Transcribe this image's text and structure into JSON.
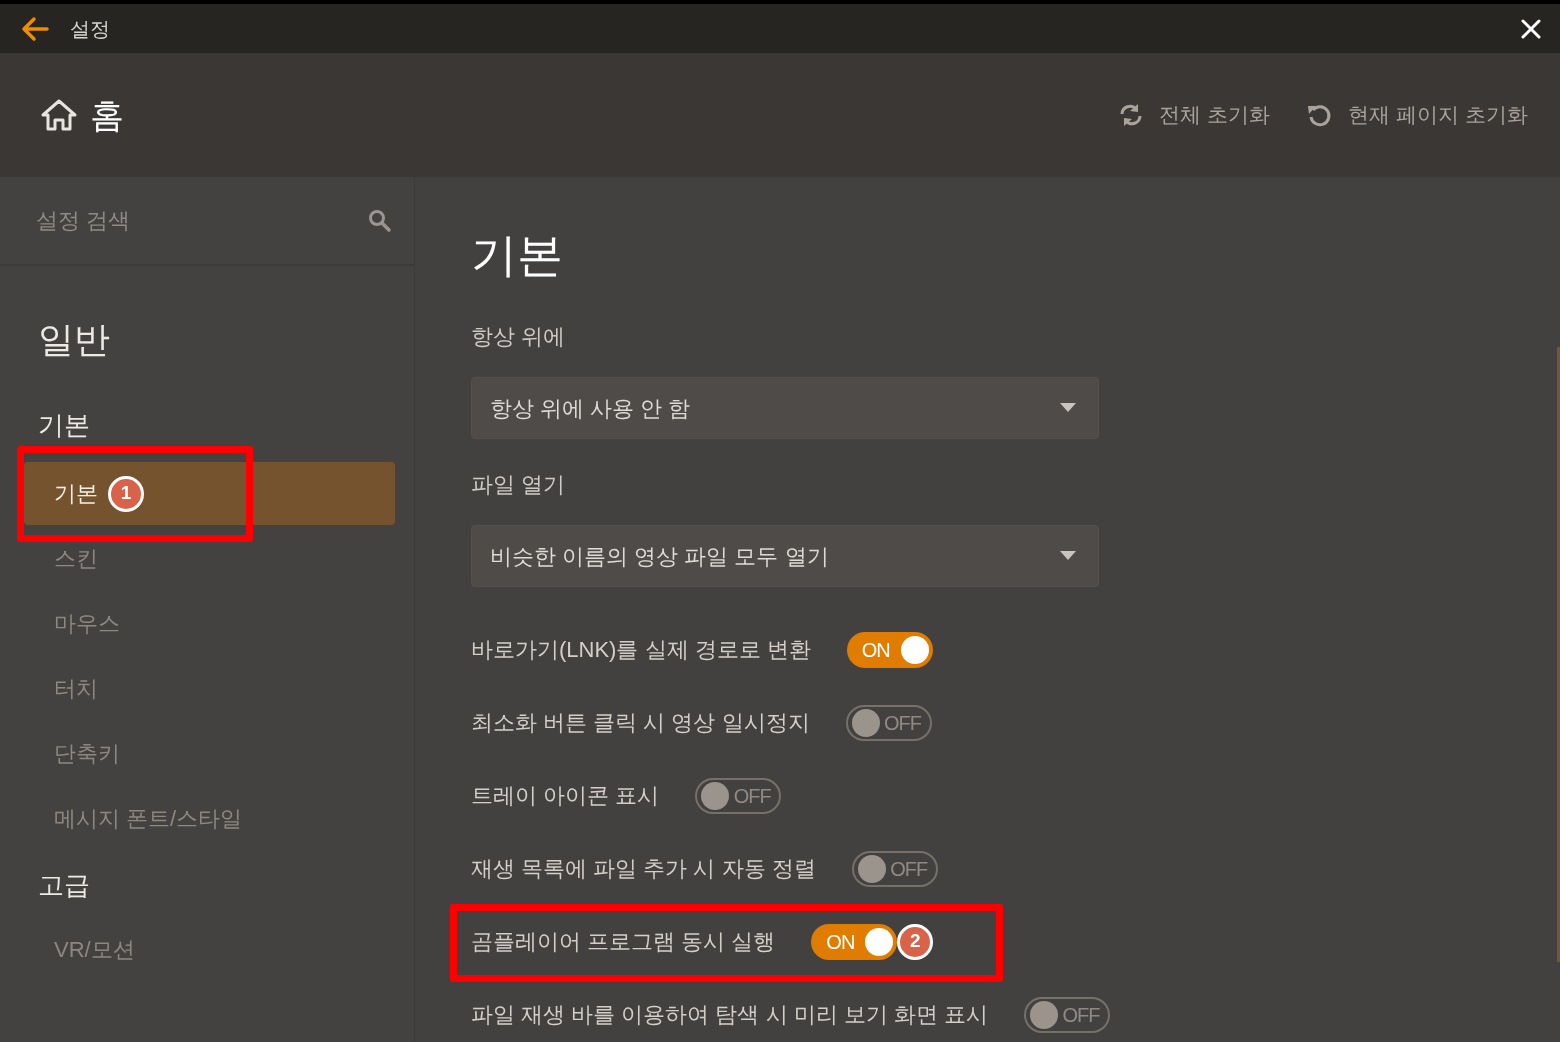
{
  "window": {
    "title": "설정"
  },
  "header": {
    "title": "홈",
    "actions": [
      {
        "label": "전체 초기화",
        "kind": "reset-all"
      },
      {
        "label": "현재 페이지 초기화",
        "kind": "reset-page"
      }
    ]
  },
  "sidebar": {
    "search": {
      "placeholder": "설정 검색"
    },
    "sections": [
      {
        "title": "일반",
        "groups": [
          {
            "title": "기본",
            "items": [
              {
                "label": "기본",
                "selected": true,
                "callout": "1"
              },
              {
                "label": "스킨",
                "selected": false
              },
              {
                "label": "마우스",
                "selected": false
              },
              {
                "label": "터치",
                "selected": false
              },
              {
                "label": "단축키",
                "selected": false
              },
              {
                "label": "메시지 폰트/스타일",
                "selected": false
              }
            ]
          },
          {
            "title": "고급",
            "items": [
              {
                "label": "VR/모션",
                "selected": false
              }
            ]
          }
        ]
      }
    ]
  },
  "content": {
    "title": "기본",
    "settings": [
      {
        "kind": "dropdown",
        "label": "항상 위에",
        "value": "항상 위에 사용 안 함"
      },
      {
        "kind": "dropdown",
        "label": "파일 열기",
        "value": "비슷한 이름의 영상 파일 모두 열기"
      },
      {
        "kind": "toggle",
        "label": "바로가기(LNK)를 실제 경로로 변환",
        "on": true,
        "state_text": "ON"
      },
      {
        "kind": "toggle",
        "label": "최소화 버튼 클릭 시 영상 일시정지",
        "on": false,
        "state_text": "OFF"
      },
      {
        "kind": "toggle",
        "label": "트레이 아이콘 표시",
        "on": false,
        "state_text": "OFF"
      },
      {
        "kind": "toggle",
        "label": "재생 목록에 파일 추가 시 자동 정렬",
        "on": false,
        "state_text": "OFF"
      },
      {
        "kind": "toggle",
        "label": "곰플레이어 프로그램 동시 실행",
        "on": true,
        "state_text": "ON",
        "callout": "2"
      },
      {
        "kind": "toggle",
        "label": "파일 재생 바를 이용하여 탐색 시 미리 보기 화면 표시",
        "on": false,
        "state_text": "OFF"
      }
    ]
  }
}
